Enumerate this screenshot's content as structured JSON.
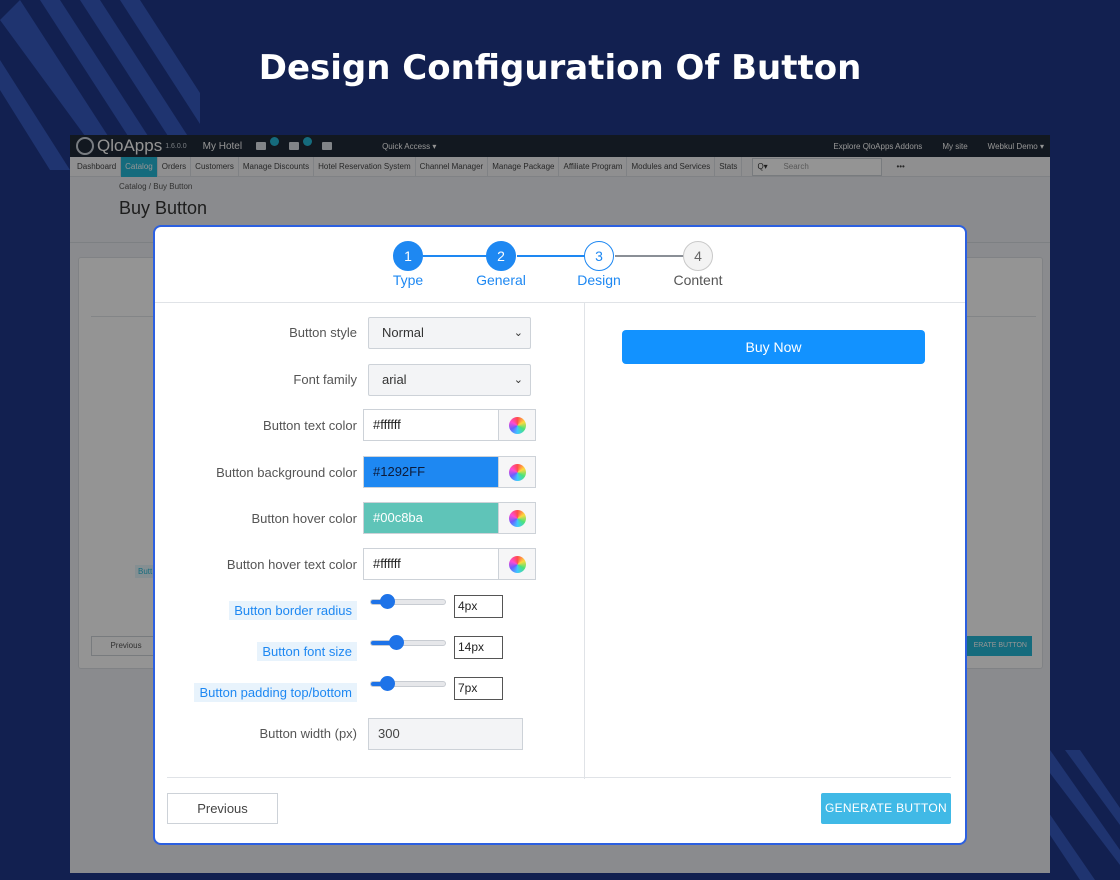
{
  "page_title": "Design Configuration Of Button",
  "app": {
    "brand": "QloApps",
    "version": "1.6.0.0",
    "hotel": "My Hotel",
    "quick_access": "Quick Access ▾",
    "explore": "Explore QloApps Addons",
    "my_site": "My site",
    "user": "Webkul Demo ▾",
    "nav": [
      "Dashboard",
      "Catalog",
      "Orders",
      "Customers",
      "Manage Discounts",
      "Hotel Reservation System",
      "Channel Manager",
      "Manage Package",
      "Affiliate Program",
      "Modules and Services",
      "Stats"
    ],
    "search_placeholder": "Search",
    "breadcrumb": "Catalog  /  Buy Button",
    "heading": "Buy Button",
    "bg_prev": "Previous",
    "bg_generate": "ERATE BUTTON",
    "bg_label": "Butt"
  },
  "steps": [
    {
      "num": "1",
      "label": "Type"
    },
    {
      "num": "2",
      "label": "General"
    },
    {
      "num": "3",
      "label": "Design"
    },
    {
      "num": "4",
      "label": "Content"
    }
  ],
  "form": {
    "button_style": {
      "label": "Button style",
      "value": "Normal"
    },
    "font_family": {
      "label": "Font family",
      "value": "arial"
    },
    "text_color": {
      "label": "Button text color",
      "value": "#ffffff"
    },
    "bg_color": {
      "label": "Button background color",
      "value": "#1292FF"
    },
    "hover_color": {
      "label": "Button hover color",
      "value": "#00c8ba"
    },
    "hover_text_color": {
      "label": "Button hover text color",
      "value": "#ffffff"
    },
    "border_radius": {
      "label": "Button border radius",
      "value": "4px",
      "level": 0.15
    },
    "font_size": {
      "label": "Button font size",
      "value": "14px",
      "level": 0.3
    },
    "padding": {
      "label": "Button padding top/bottom",
      "value": "7px",
      "level": 0.15
    },
    "width": {
      "label": "Button width (px)",
      "value": "300"
    }
  },
  "preview": {
    "label": "Buy Now",
    "color": "#1292FF"
  },
  "colors": {
    "bg_field": "#1e88f2",
    "hover_field": "#5fc4b8"
  },
  "footer": {
    "previous": "Previous",
    "generate": "GENERATE BUTTON"
  }
}
